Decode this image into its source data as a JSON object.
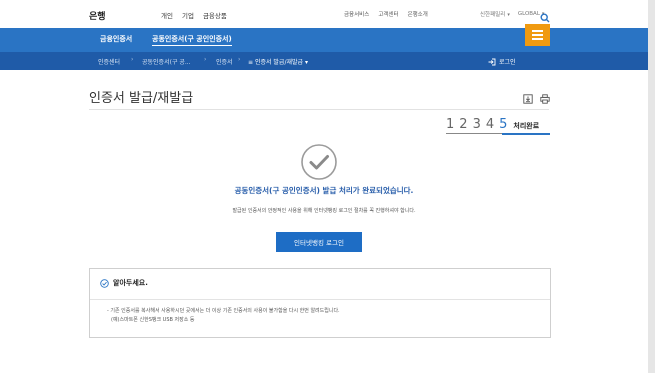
{
  "brand": {
    "logo": "은행"
  },
  "top_nav": [
    "개인",
    "기업",
    "금융상품"
  ],
  "utility_links": [
    "금융서비스",
    "고객센터",
    "은행소개"
  ],
  "lang": {
    "family_sites": "신한패밀리",
    "global": "GLOBAL"
  },
  "icons": {
    "search": "search-icon",
    "menu": "hamburger-menu-icon",
    "download": "download-icon",
    "print": "print-icon",
    "check": "check-circle-icon",
    "login": "login-icon"
  },
  "main_nav": {
    "category1": "금융인증서",
    "category2": "공동인증서(구 공인인증서)"
  },
  "breadcrumb": [
    "인증센터",
    "공동인증서(구 공...",
    "인증서",
    "인증서 발급/재발급"
  ],
  "login_label": "로그인",
  "page_title": "인증서 발급/재발급",
  "steps": {
    "items": [
      "1",
      "2",
      "3",
      "4",
      "5"
    ],
    "current_label": "처리완료"
  },
  "result": {
    "message": "공동인증서(구 공인인증서) 발급 처리가 완료되었습니다.",
    "sub": "발급된 인증서의 안정적인 사용을 위해 인터넷뱅킹 로그인 절차를 꼭 진행하셔야 합니다.",
    "button": "인터넷뱅킹 로그인"
  },
  "notice": {
    "title": "알아두세요.",
    "line1": "- 기존 인증서를 복사해서 사용하시던 곳에서는 더 이상 기존 인증서의 사용이 불가함을 다시 한번 알려드립니다.",
    "line2": "(예)스마트폰 신한S뱅크 USB 저장소 등"
  },
  "colors": {
    "primary": "#2a74c4",
    "breadcrumb_bg": "#1f5ba8",
    "accent_menu": "#f09a10",
    "button": "#1e6dc5"
  }
}
